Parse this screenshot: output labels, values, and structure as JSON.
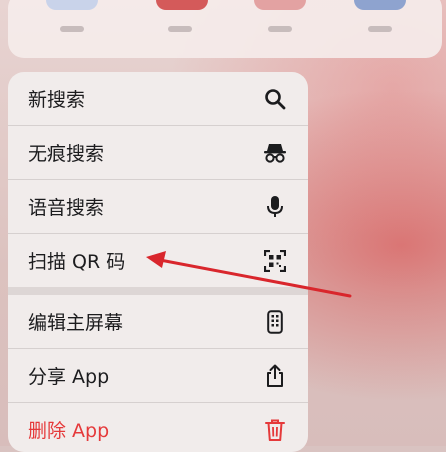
{
  "menu": {
    "items": [
      {
        "label": "新搜索",
        "icon": "search-icon"
      },
      {
        "label": "无痕搜索",
        "icon": "incognito-icon"
      },
      {
        "label": "语音搜索",
        "icon": "microphone-icon"
      },
      {
        "label": "扫描 QR 码",
        "icon": "qr-scan-icon"
      },
      {
        "label": "编辑主屏幕",
        "icon": "phone-screen-icon"
      },
      {
        "label": "分享 App",
        "icon": "share-icon"
      },
      {
        "label": "删除 App",
        "icon": "trash-icon"
      }
    ]
  },
  "colors": {
    "danger": "#e5393a",
    "annotation_arrow": "#d9262c",
    "icon": "#1c1c1e"
  }
}
